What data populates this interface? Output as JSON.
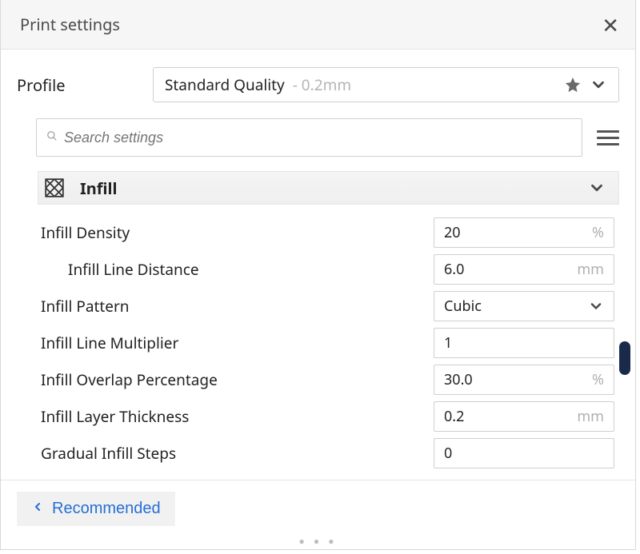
{
  "titlebar": {
    "title": "Print settings"
  },
  "profile": {
    "label": "Profile",
    "name": "Standard Quality",
    "detail": "- 0.2mm"
  },
  "search": {
    "placeholder": "Search settings"
  },
  "section": {
    "title": "Infill"
  },
  "settings": [
    {
      "label": "Infill Density",
      "value": "20",
      "unit": "%",
      "type": "number",
      "indent": false
    },
    {
      "label": "Infill Line Distance",
      "value": "6.0",
      "unit": "mm",
      "type": "number",
      "indent": true
    },
    {
      "label": "Infill Pattern",
      "value": "Cubic",
      "unit": "",
      "type": "select",
      "indent": false
    },
    {
      "label": "Infill Line Multiplier",
      "value": "1",
      "unit": "",
      "type": "number",
      "indent": false
    },
    {
      "label": "Infill Overlap Percentage",
      "value": "30.0",
      "unit": "%",
      "type": "number",
      "indent": false
    },
    {
      "label": "Infill Layer Thickness",
      "value": "0.2",
      "unit": "mm",
      "type": "number",
      "indent": false
    },
    {
      "label": "Gradual Infill Steps",
      "value": "0",
      "unit": "",
      "type": "number",
      "indent": false
    }
  ],
  "footer": {
    "recommended": "Recommended"
  }
}
